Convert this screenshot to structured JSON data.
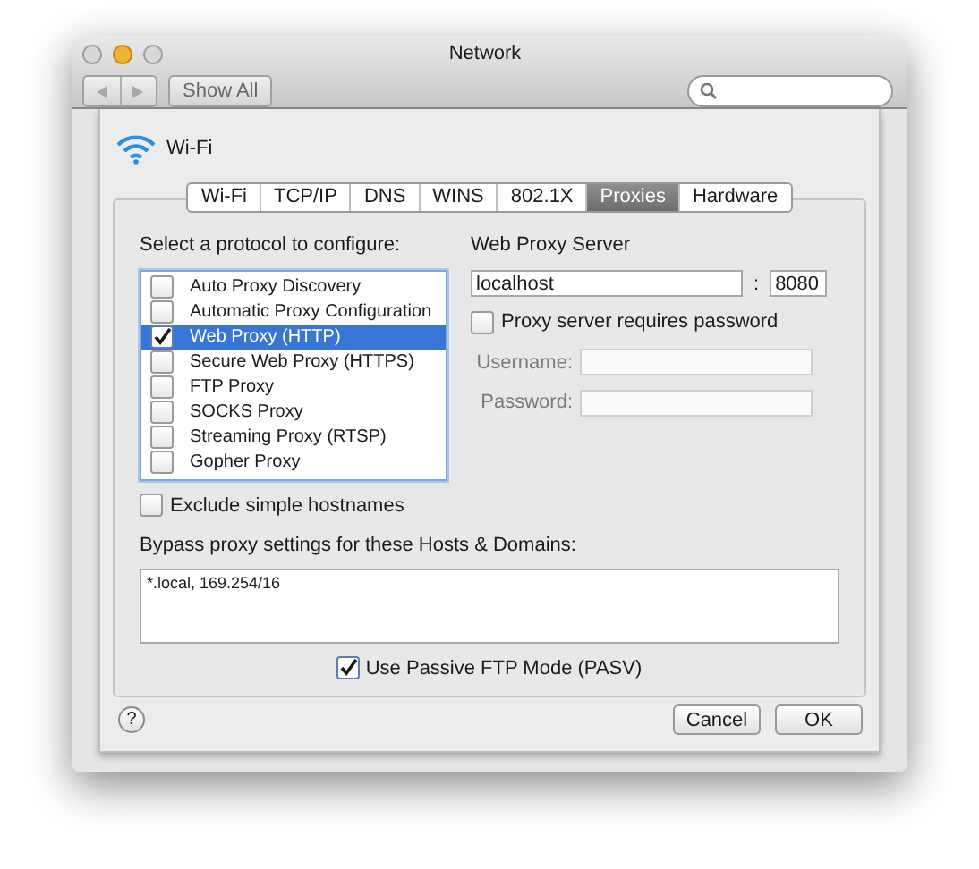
{
  "window": {
    "title": "Network"
  },
  "toolbar": {
    "show_all": "Show All"
  },
  "service": {
    "name": "Wi-Fi"
  },
  "tabs": [
    {
      "label": "Wi-Fi",
      "selected": false
    },
    {
      "label": "TCP/IP",
      "selected": false
    },
    {
      "label": "DNS",
      "selected": false
    },
    {
      "label": "WINS",
      "selected": false
    },
    {
      "label": "802.1X",
      "selected": false
    },
    {
      "label": "Proxies",
      "selected": true
    },
    {
      "label": "Hardware",
      "selected": false
    }
  ],
  "protocols": {
    "heading": "Select a protocol to configure:",
    "items": [
      {
        "label": "Auto Proxy Discovery",
        "checked": false,
        "selected": false
      },
      {
        "label": "Automatic Proxy Configuration",
        "checked": false,
        "selected": false
      },
      {
        "label": "Web Proxy (HTTP)",
        "checked": true,
        "selected": true
      },
      {
        "label": "Secure Web Proxy (HTTPS)",
        "checked": false,
        "selected": false
      },
      {
        "label": "FTP Proxy",
        "checked": false,
        "selected": false
      },
      {
        "label": "SOCKS Proxy",
        "checked": false,
        "selected": false
      },
      {
        "label": "Streaming Proxy (RTSP)",
        "checked": false,
        "selected": false
      },
      {
        "label": "Gopher Proxy",
        "checked": false,
        "selected": false
      }
    ]
  },
  "server": {
    "heading": "Web Proxy Server",
    "host": "localhost",
    "separator": ":",
    "port": "8080",
    "requires_password": {
      "label": "Proxy server requires password",
      "checked": false
    },
    "username": {
      "label": "Username:",
      "disabled": true
    },
    "password": {
      "label": "Password:",
      "disabled": true
    }
  },
  "exclude_simple": {
    "label": "Exclude simple hostnames",
    "checked": false
  },
  "bypass": {
    "label": "Bypass proxy settings for these Hosts & Domains:",
    "value": "*.local, 169.254/16"
  },
  "passive_ftp": {
    "label": "Use Passive FTP Mode (PASV)",
    "checked": true
  },
  "help": {
    "label": "?"
  },
  "buttons": [
    {
      "label": "Cancel",
      "default": false
    },
    {
      "label": "OK",
      "default": false
    }
  ]
}
